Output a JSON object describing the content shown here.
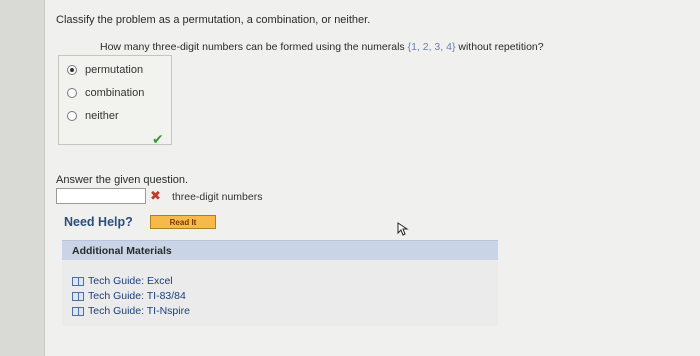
{
  "question": {
    "prompt": "Classify the problem as a permutation, a combination, or neither.",
    "subquestion_prefix": "How many three-digit numbers can be formed using the numerals",
    "subquestion_set": "{1, 2, 3, 4}",
    "subquestion_suffix": "without repetition?"
  },
  "choices": [
    {
      "label": "permutation",
      "selected": true
    },
    {
      "label": "combination",
      "selected": false
    },
    {
      "label": "neither",
      "selected": false
    }
  ],
  "answer": {
    "label": "Answer the given question.",
    "value": "",
    "units": "three-digit numbers"
  },
  "help": {
    "need_help": "Need Help?",
    "read_it": "Read It"
  },
  "additional": {
    "title": "Additional Materials",
    "items": [
      "Tech Guide: Excel",
      "Tech Guide: TI-83/84",
      "Tech Guide: TI-Nspire"
    ]
  },
  "colors": {
    "accent_blue": "#2b4f7a",
    "correct_green": "#3a9a3a",
    "incorrect_red": "#c03a2b",
    "read_it_orange": "#f7b94a"
  },
  "icons": {
    "check": "checkmark-icon",
    "wrong": "x-icon",
    "book": "book-icon",
    "cursor": "mouse-cursor-icon"
  }
}
